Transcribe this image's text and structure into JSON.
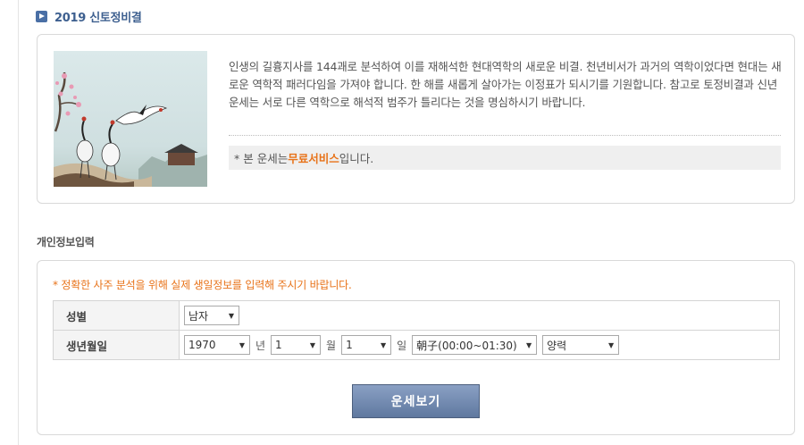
{
  "page": {
    "title": "2019 신토정비결"
  },
  "intro": {
    "description": "인생의 길흉지사를 144괘로 분석하여 이를 재해석한 현대역학의 새로운 비결. 천년비서가 과거의 역학이었다면 현대는 새로운 역학적 패러다임을 가져야 합니다. 한 해를 새롭게 살아가는 이정표가 되시기를 기원합니다. 참고로 토정비결과 신년운세는 서로 다른 역학으로 해석적 범주가 틀리다는 것을 명심하시기 바랍니다.",
    "notice_prefix": "* 본 운세는 ",
    "notice_highlight": "무료서비스",
    "notice_suffix": " 입니다."
  },
  "personal_info": {
    "section_label": "개인정보입력",
    "notice": "* 정확한 사주 분석을 위해 실제 생일정보를 입력해 주시기 바랍니다.",
    "gender": {
      "label": "성별",
      "value": "남자"
    },
    "birth": {
      "label": "생년월일",
      "year": "1970",
      "year_unit": "년",
      "month": "1",
      "month_unit": "월",
      "day": "1",
      "day_unit": "일",
      "hour": "朝子(00:00~01:30)",
      "calendar": "양력"
    },
    "submit_label": "운세보기"
  },
  "colors": {
    "accent": "#e8731a",
    "title": "#3d5f8f",
    "button": "#6f87ae"
  }
}
